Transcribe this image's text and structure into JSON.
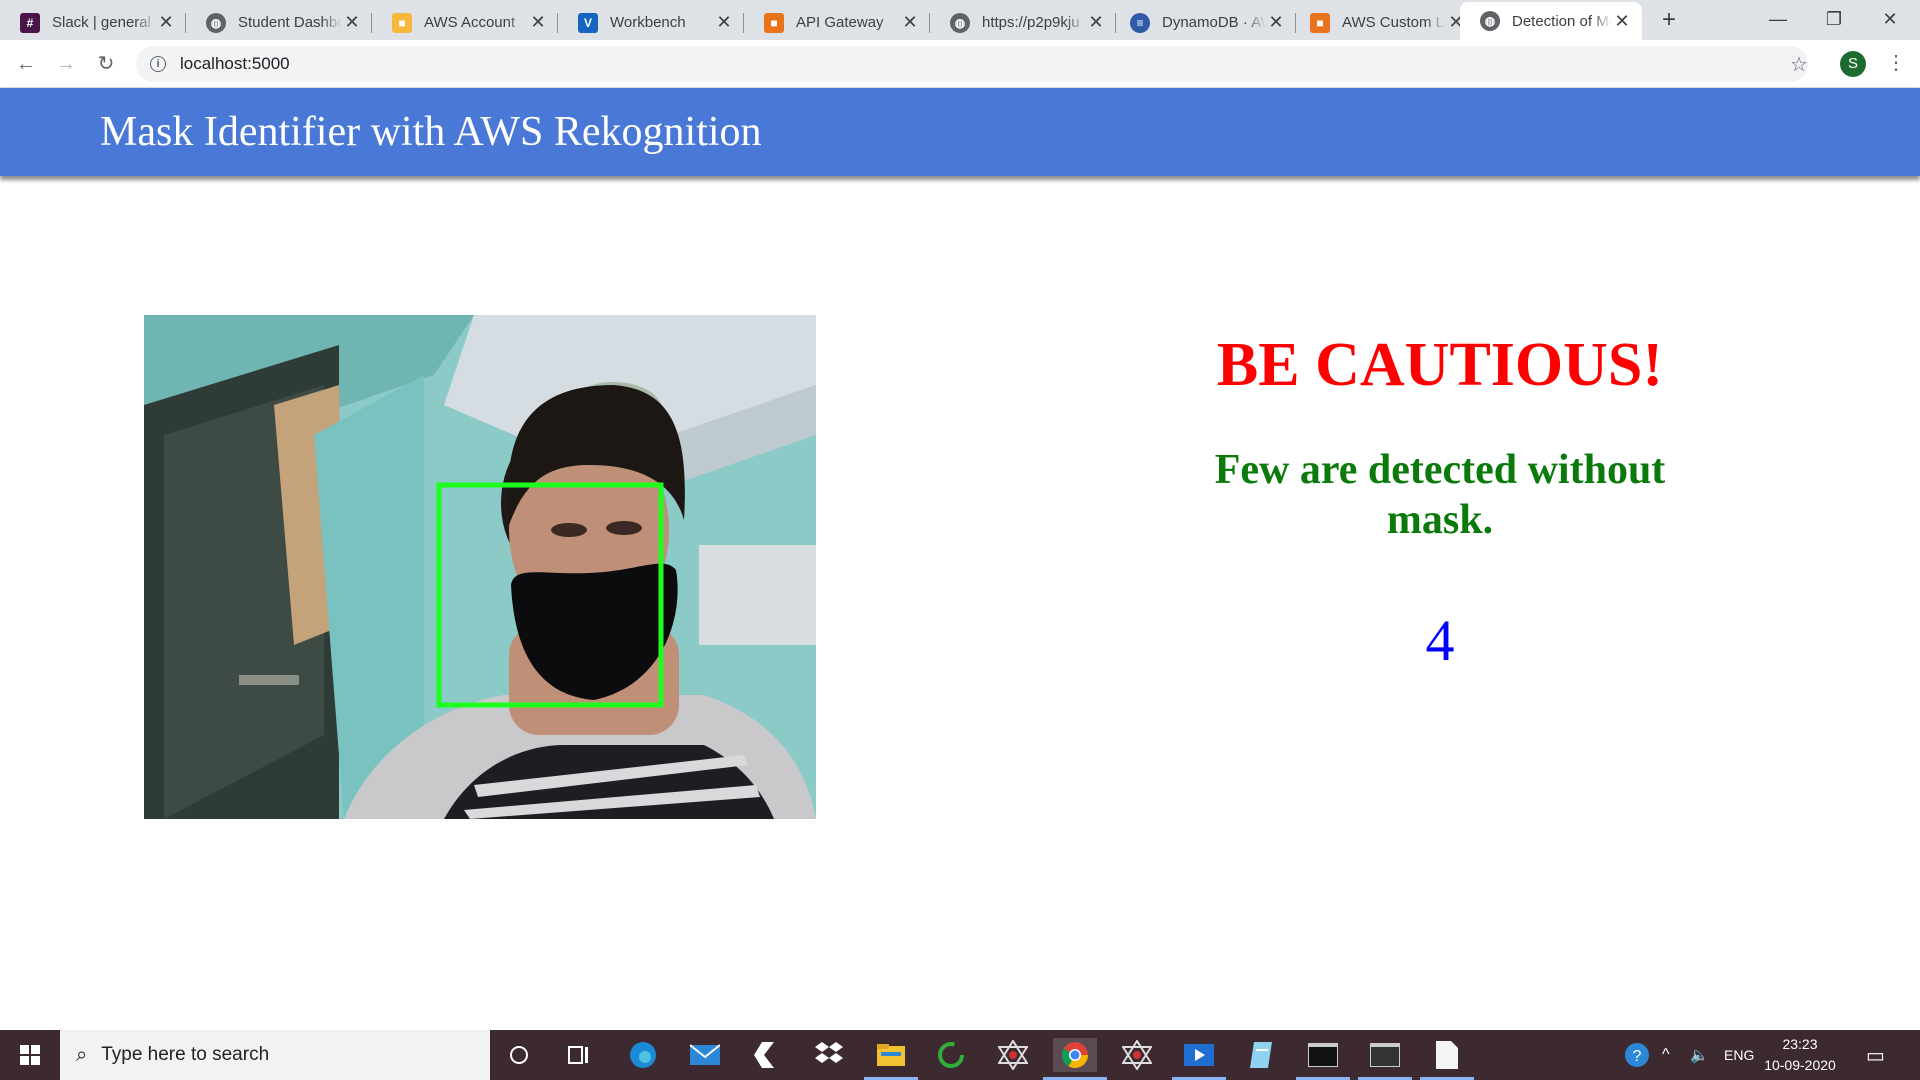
{
  "browser": {
    "tabs": [
      {
        "title": "Slack | general",
        "icon": "slack-icon",
        "color": "#4a154b"
      },
      {
        "title": "Student Dashboard",
        "icon": "globe-icon",
        "color": "#5f6368"
      },
      {
        "title": "AWS Account",
        "icon": "aws-cube-icon",
        "color": "#f6b73c"
      },
      {
        "title": "Workbench",
        "icon": "vocareum-icon",
        "color": "#1565c0"
      },
      {
        "title": "API Gateway",
        "icon": "api-gateway-icon",
        "color": "#e8731b"
      },
      {
        "title": "https://p2p9kju",
        "icon": "globe-icon",
        "color": "#5f6368"
      },
      {
        "title": "DynamoDB · AWS",
        "icon": "dynamodb-icon",
        "color": "#2e5aa8"
      },
      {
        "title": "AWS Custom Labels",
        "icon": "aws-custom-labels-icon",
        "color": "#e8731b"
      },
      {
        "title": "Detection of Mask",
        "icon": "globe-icon",
        "color": "#5f6368"
      }
    ],
    "url": "localhost:5000",
    "profile_initial": "S"
  },
  "page": {
    "app_title": "Mask Identifier with AWS Rekognition",
    "warning": "BE CAUTIOUS!",
    "message": "Few are detected without mask.",
    "count": "4",
    "colors": {
      "header": "#4a78d7",
      "warning": "#ff0000",
      "message": "#0a7a0a",
      "count": "#0000ff",
      "face_box": "#00ff00"
    }
  },
  "taskbar": {
    "search_placeholder": "Type here to search",
    "apps": [
      "cortana-icon",
      "task-view-icon",
      "edge-icon",
      "mail-icon",
      "visual-studio-icon",
      "dropbox-icon",
      "file-explorer-icon",
      "green-refresh-icon",
      "network-app-icon",
      "chrome-icon",
      "network-app-icon",
      "media-player-icon",
      "notepad-icon",
      "terminal-icon",
      "terminal-icon",
      "file-icon"
    ],
    "language": "ENG",
    "time": "23:23",
    "date": "10-09-2020"
  }
}
